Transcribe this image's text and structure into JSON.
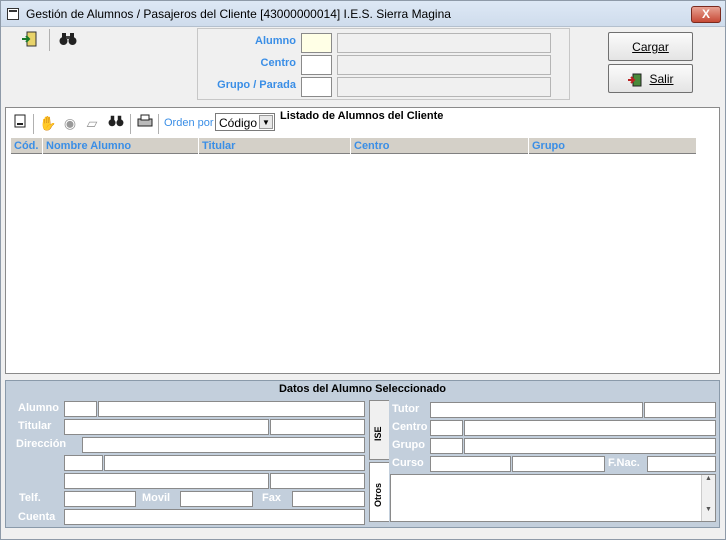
{
  "window": {
    "title": "Gestión de Alumnos / Pasajeros del Cliente [43000000014] I.E.S. Sierra Magina",
    "close": "X"
  },
  "filter": {
    "alumno_label": "Alumno",
    "centro_label": "Centro",
    "grupo_label": "Grupo / Parada"
  },
  "buttons": {
    "cargar": "Cargar",
    "salir": "Salir"
  },
  "list": {
    "title": "Listado de Alumnos del Cliente",
    "orden_label": "Orden por",
    "orden_value": "Código",
    "columns": [
      "Cód.",
      "Nombre Alumno",
      "Titular",
      "Centro",
      "Grupo"
    ]
  },
  "detail": {
    "title": "Datos del Alumno Seleccionado",
    "labels": {
      "alumno": "Alumno",
      "titular": "Titular",
      "direccion": "Dirección",
      "telf": "Telf.",
      "movil": "Movil",
      "fax": "Fax",
      "cuenta": "Cuenta",
      "tutor": "Tutor",
      "centro": "Centro",
      "grupo": "Grupo",
      "curso": "Curso",
      "fnac": "F.Nac."
    },
    "tabs": {
      "ise": "ISE",
      "otros": "Otros"
    }
  },
  "icons": [
    "exit-icon",
    "binoculars-icon",
    "new-doc-icon",
    "hand-icon",
    "eye-icon",
    "eraser-icon",
    "search-icon",
    "print-icon",
    "door-icon"
  ]
}
